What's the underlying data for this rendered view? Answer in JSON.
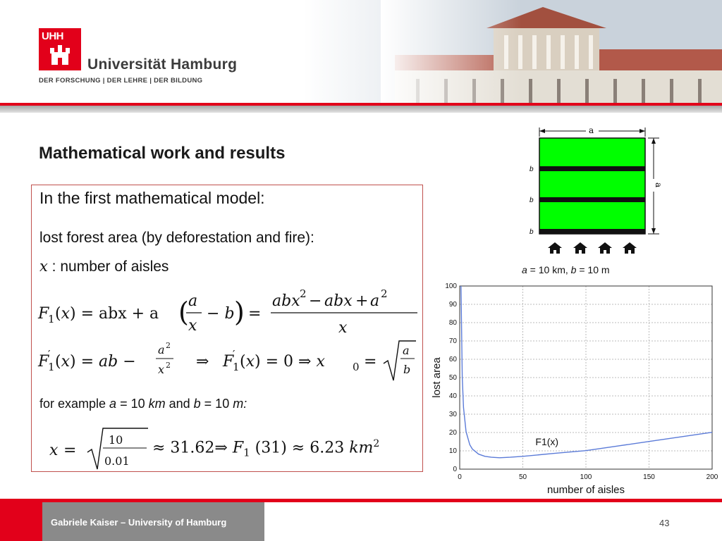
{
  "header": {
    "logo_text": "UHH",
    "university": "Universität Hamburg",
    "tagline": "DER FORSCHUNG | DER LEHRE | DER BILDUNG"
  },
  "slide": {
    "title": "Mathematical work and results",
    "intro": "In the first mathematical model:",
    "lost_area_line": "lost forest area (by deforestation and fire):",
    "x_desc": " : number of aisles",
    "example": {
      "prefix": "for example ",
      "a_val": " = 10 ",
      "a_unit": "km",
      "and": " and ",
      "b_val": " = 10 ",
      "b_unit": "m:"
    },
    "formula_result": {
      "approx_x": "≈ 31.62⇒ ",
      "approx_f": " (31) ≈ 6.23 ",
      "unit": "km"
    }
  },
  "diagram": {
    "label_a": "a",
    "label_b": "b",
    "caption_a": "a",
    "caption_a_val": " = 10 km, ",
    "caption_b": "b",
    "caption_b_val": " = 10 m",
    "field_color": "#00ff00"
  },
  "chart_data": {
    "type": "line",
    "xlabel": "number of aisles",
    "ylabel": "lost area",
    "xlim": [
      0,
      200
    ],
    "ylim": [
      0,
      100
    ],
    "xticks": [
      0,
      50,
      100,
      150,
      200
    ],
    "yticks": [
      0,
      10,
      20,
      30,
      40,
      50,
      60,
      70,
      80,
      90,
      100
    ],
    "grid": true,
    "annotation": "F1(x)",
    "series": [
      {
        "color": "#5b7bd8",
        "x": [
          1,
          2,
          3,
          5,
          8,
          10,
          15,
          20,
          25,
          31.62,
          40,
          50,
          75,
          100,
          125,
          150,
          175,
          200
        ],
        "y": [
          100.1,
          50.2,
          33.6,
          20.5,
          13.3,
          11.0,
          8.2,
          7.0,
          6.5,
          6.23,
          6.5,
          7.0,
          8.6,
          10.1,
          12.6,
          15.1,
          17.6,
          20.1
        ]
      }
    ]
  },
  "footer": {
    "author": "Gabriele Kaiser – University of Hamburg",
    "page": "43"
  }
}
